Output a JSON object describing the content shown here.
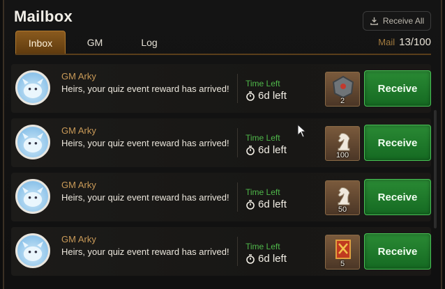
{
  "header": {
    "title": "Mailbox",
    "receive_all_label": "Receive All"
  },
  "tabs": [
    {
      "label": "Inbox",
      "active": true
    },
    {
      "label": "GM",
      "active": false
    },
    {
      "label": "Log",
      "active": false
    }
  ],
  "mail_counter": {
    "label": "Mail",
    "value": "13/100"
  },
  "mails": [
    {
      "sender": "GM Arky",
      "message": "Heirs, your quiz event reward has arrived!",
      "time_label": "Time Left",
      "time_value": "6d left",
      "item_icon": "gem-stone-icon",
      "item_qty": "2",
      "button_label": "Receive"
    },
    {
      "sender": "GM Arky",
      "message": "Heirs, your quiz event reward has arrived!",
      "time_label": "Time Left",
      "time_value": "6d left",
      "item_icon": "chess-knight-icon",
      "item_qty": "100",
      "button_label": "Receive"
    },
    {
      "sender": "GM Arky",
      "message": "Heirs, your quiz event reward has arrived!",
      "time_label": "Time Left",
      "time_value": "6d left",
      "item_icon": "chess-knight-icon",
      "item_qty": "50",
      "button_label": "Receive"
    },
    {
      "sender": "GM Arky",
      "message": "Heirs, your quiz event reward has arrived!",
      "time_label": "Time Left",
      "time_value": "6d left",
      "item_icon": "crossed-swords-banner-icon",
      "item_qty": "5",
      "button_label": "Receive"
    }
  ],
  "colors": {
    "accent_gold": "#c99a58",
    "time_green": "#4fb84a",
    "receive_green": "#1f7a2c"
  }
}
